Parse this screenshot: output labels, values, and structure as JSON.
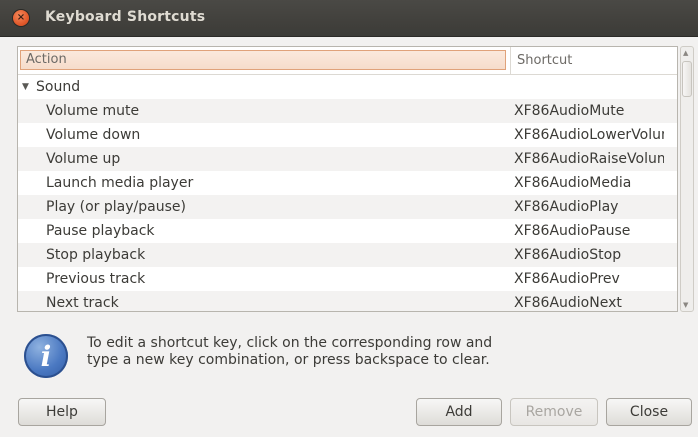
{
  "window": {
    "title": "Keyboard Shortcuts",
    "close_glyph": "×"
  },
  "tree": {
    "columns": {
      "action": "Action",
      "shortcut": "Shortcut"
    },
    "group": {
      "label": "Sound",
      "expander": "▼"
    },
    "rows": [
      {
        "action": "Volume mute",
        "shortcut": "XF86AudioMute"
      },
      {
        "action": "Volume down",
        "shortcut": "XF86AudioLowerVolum"
      },
      {
        "action": "Volume up",
        "shortcut": "XF86AudioRaiseVolum"
      },
      {
        "action": "Launch media player",
        "shortcut": "XF86AudioMedia"
      },
      {
        "action": "Play (or play/pause)",
        "shortcut": "XF86AudioPlay"
      },
      {
        "action": "Pause playback",
        "shortcut": "XF86AudioPause"
      },
      {
        "action": "Stop playback",
        "shortcut": "XF86AudioStop"
      },
      {
        "action": "Previous track",
        "shortcut": "XF86AudioPrev"
      },
      {
        "action": "Next track",
        "shortcut": "XF86AudioNext"
      }
    ]
  },
  "scrollbar": {
    "up_glyph": "▲",
    "down_glyph": "▼"
  },
  "info": {
    "icon": "info-icon",
    "icon_glyph": "i",
    "line1": "To edit a shortcut key, click on the corresponding row and",
    "line2": "type a new key combination, or press backspace to clear."
  },
  "buttons": {
    "help": "Help",
    "add": "Add",
    "remove": "Remove",
    "close": "Close"
  },
  "colors": {
    "titlebar": "#3c3b37",
    "close_button": "#e25a2c",
    "header_highlight": "#fbe9dc",
    "info_icon": "#4b79c2"
  }
}
